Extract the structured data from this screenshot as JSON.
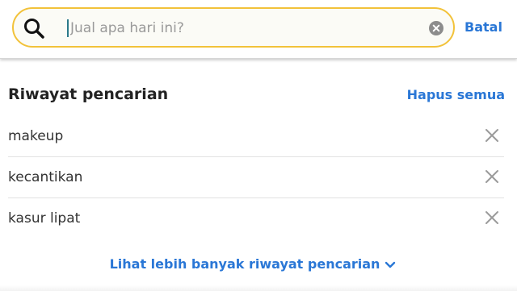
{
  "search": {
    "placeholder": "Jual apa hari ini?",
    "value": ""
  },
  "header": {
    "cancel_label": "Batal"
  },
  "history": {
    "title": "Riwayat pencarian",
    "clear_all_label": "Hapus semua",
    "items": [
      {
        "label": "makeup"
      },
      {
        "label": "kecantikan"
      },
      {
        "label": "kasur lipat"
      }
    ],
    "show_more_label": "Lihat lebih banyak riwayat pencarian"
  },
  "icons": {
    "search": "search-icon",
    "clear": "clear-circle-icon",
    "remove": "close-icon",
    "show_more": "chevron-down-icon"
  },
  "colors": {
    "accent": "#2a77d6",
    "search_border": "#f2c23a",
    "text": "#333333"
  }
}
